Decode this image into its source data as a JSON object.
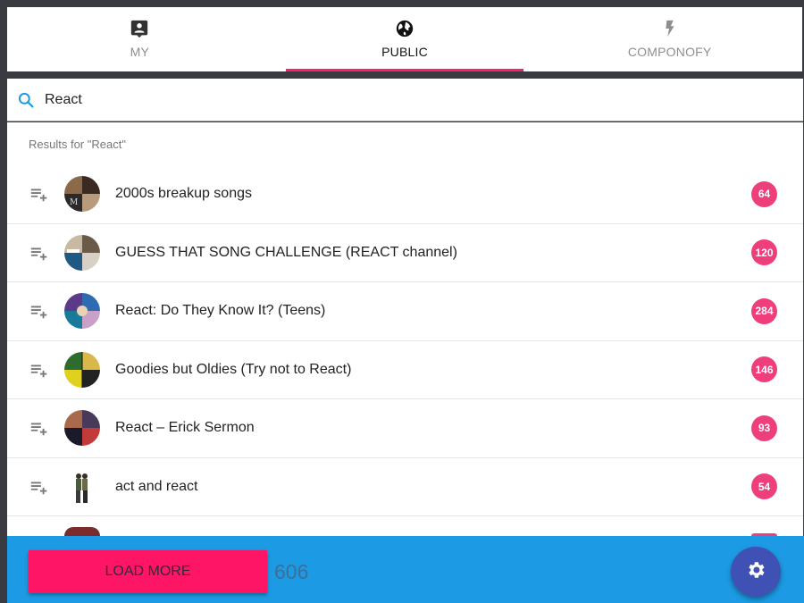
{
  "tabs": [
    {
      "label": "MY",
      "icon": "account-box-icon",
      "active": false
    },
    {
      "label": "PUBLIC",
      "icon": "globe-icon",
      "active": true
    },
    {
      "label": "COMPONOFY",
      "icon": "lightning-icon",
      "active": false
    }
  ],
  "search": {
    "value": "React",
    "icon": "search-icon"
  },
  "results": {
    "header": "Results for \"React\"",
    "items": [
      {
        "title": "2000s breakup songs",
        "count": "64"
      },
      {
        "title": "GUESS THAT SONG CHALLENGE (REACT channel)",
        "count": "120"
      },
      {
        "title": "React: Do They Know It? (Teens)",
        "count": "284"
      },
      {
        "title": "Goodies but Oldies (Try not to React)",
        "count": "146"
      },
      {
        "title": "React – Erick Sermon",
        "count": "93"
      },
      {
        "title": "act and react",
        "count": "54"
      }
    ]
  },
  "footer": {
    "load_more_label": "LOAD MORE",
    "total_count": "606",
    "fab_icon": "gear-icon"
  },
  "colors": {
    "accent": "#ff1e6e",
    "badge": "#ef3e7c",
    "footer": "#1c9be4",
    "fab": "#3f51b5"
  }
}
